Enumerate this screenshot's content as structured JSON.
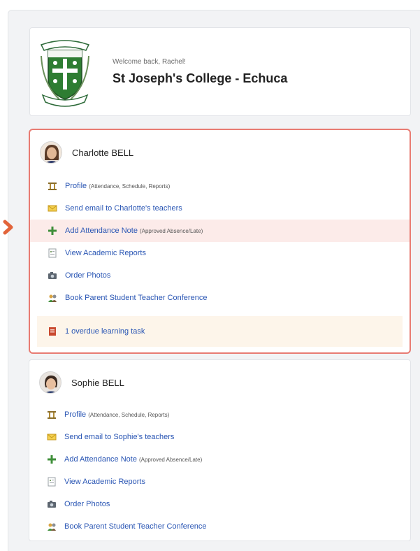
{
  "school": {
    "welcome": "Welcome back, Rachel!",
    "name": "St Joseph's College - Echuca"
  },
  "students": [
    {
      "name": "Charlotte BELL",
      "selected": true,
      "links": {
        "profile": "Profile",
        "profile_sub": "(Attendance, Schedule, Reports)",
        "email": "Send email to Charlotte's teachers",
        "attendance": "Add Attendance Note",
        "attendance_sub": "(Approved Absence/Late)",
        "reports": "View Academic Reports",
        "photos": "Order Photos",
        "conference": "Book Parent Student Teacher Conference",
        "task": "1 overdue learning task"
      }
    },
    {
      "name": "Sophie BELL",
      "selected": false,
      "links": {
        "profile": "Profile",
        "profile_sub": "(Attendance, Schedule, Reports)",
        "email": "Send email to Sophie's teachers",
        "attendance": "Add Attendance Note",
        "attendance_sub": "(Approved Absence/Late)",
        "reports": "View Academic Reports",
        "photos": "Order Photos",
        "conference": "Book Parent Student Teacher Conference"
      }
    }
  ],
  "icons": {
    "profile": "profile-icon",
    "email": "envelope-icon",
    "attendance": "plus-icon",
    "reports": "report-icon",
    "photos": "camera-icon",
    "conference": "conference-icon",
    "task": "task-icon",
    "pointer": "chevron-right-icon"
  },
  "colors": {
    "link": "#2a56b4",
    "selected_border": "#e87b72",
    "highlight_row": "#fcebe9",
    "task_row": "#fdf5ea",
    "accent_green": "#2e7d32"
  }
}
